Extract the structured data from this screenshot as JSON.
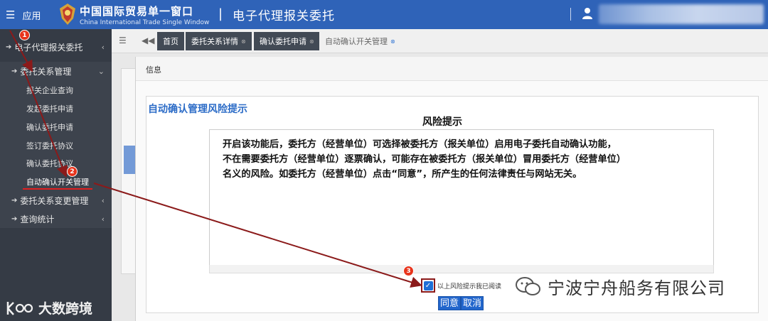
{
  "header": {
    "menu_label": "应用",
    "brand_cn": "中国国际贸易单一窗口",
    "brand_en": "China International Trade Single Window",
    "separator": "|",
    "system_title": "电子代理报关委托"
  },
  "sidebar": {
    "top_item": "电子代理报关委托",
    "group1": "委托关系管理",
    "sub_items": [
      "报关企业查询",
      "发起委托申请",
      "确认委托申请",
      "签订委托协议",
      "确认委托协议",
      "自动确认开关管理"
    ],
    "group2": "委托关系变更管理",
    "group3": "查询统计"
  },
  "tabs": {
    "items": [
      {
        "label": "首页",
        "close": ""
      },
      {
        "label": "委托关系详情",
        "close": "⊗"
      },
      {
        "label": "确认委托申请",
        "close": "⊗"
      },
      {
        "label": "自动确认开关管理",
        "close": "⊗"
      }
    ]
  },
  "dialog": {
    "header": "信息",
    "title": "自动确认管理风险提示",
    "subtitle": "风险提示",
    "text_lines": [
      "开启该功能后，委托方（经营单位）可选择被委托方（报关单位）启用电子委托自动确认功能，",
      "不在需要委托方（经营单位）逐票确认，可能存在被委托方（报关单位）冒用委托方（经营单位）",
      "名义的风险。如委托方（经营单位）点击“同意”，所产生的任何法律责任与网站无关。"
    ],
    "checkbox_label": "以上风险提示我已阅读",
    "checkbox_checked": true,
    "agree_button": "同意",
    "cancel_button": "取消"
  },
  "annotations": {
    "badges": [
      "1",
      "2",
      "3"
    ],
    "color": "#8b1a1a"
  },
  "watermarks": {
    "left": "大数跨境",
    "right": "宁波宁舟船务有限公司"
  }
}
